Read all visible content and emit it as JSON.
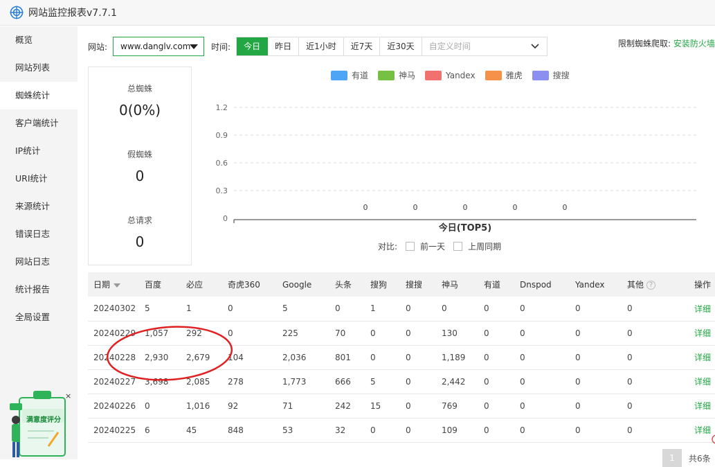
{
  "app": {
    "title": "网站监控报表v7.7.1"
  },
  "sidebar": {
    "items": [
      {
        "label": "概览"
      },
      {
        "label": "网站列表"
      },
      {
        "label": "蜘蛛统计"
      },
      {
        "label": "客户端统计"
      },
      {
        "label": "IP统计"
      },
      {
        "label": "URI统计"
      },
      {
        "label": "来源统计"
      },
      {
        "label": "错误日志"
      },
      {
        "label": "网站日志"
      },
      {
        "label": "统计报告"
      },
      {
        "label": "全局设置"
      }
    ],
    "active_index": 2
  },
  "filter": {
    "site_label": "网站:",
    "site_value": "www.danglv.com",
    "time_label": "时间:",
    "time_buttons": [
      "今日",
      "昨日",
      "近1小时",
      "近7天",
      "近30天"
    ],
    "active_time": "今日",
    "custom_time_placeholder": "自定义时间",
    "limit_label": "限制蜘蛛爬取:",
    "limit_link": "安装防火墙"
  },
  "stats": {
    "total_spider_label": "总蜘蛛",
    "total_spider_value": "0(0%)",
    "fake_spider_label": "假蜘蛛",
    "fake_spider_value": "0",
    "total_requests_label": "总请求",
    "total_requests_value": "0"
  },
  "chart_data": {
    "type": "bar",
    "xlabel": "今日(TOP5)",
    "ylim": [
      0,
      1.2
    ],
    "yticks": [
      "1.2",
      "0.9",
      "0.6",
      "0.3",
      "0"
    ],
    "grid": true,
    "legend": "top",
    "series": [
      {
        "name": "有道",
        "color": "#4ea5f5",
        "values": [
          0
        ]
      },
      {
        "name": "神马",
        "color": "#76c043",
        "values": [
          0
        ]
      },
      {
        "name": "Yandex",
        "color": "#f0716e",
        "values": [
          0
        ]
      },
      {
        "name": "雅虎",
        "color": "#f6914a",
        "values": [
          0
        ]
      },
      {
        "name": "搜搜",
        "color": "#8b8ff0",
        "values": [
          0
        ]
      }
    ],
    "value_labels": [
      "0",
      "0",
      "0",
      "0",
      "0"
    ]
  },
  "compare": {
    "label": "对比:",
    "options": [
      "前一天",
      "上周同期"
    ]
  },
  "table": {
    "columns": [
      "日期",
      "百度",
      "必应",
      "奇虎360",
      "Google",
      "头条",
      "搜狗",
      "搜搜",
      "神马",
      "有道",
      "Dnspod",
      "Yandex",
      "其他",
      "操作"
    ],
    "rows": [
      [
        "20240302",
        "5",
        "1",
        "0",
        "5",
        "0",
        "1",
        "0",
        "0",
        "0",
        "0",
        "0",
        "0",
        "详细"
      ],
      [
        "20240229",
        "1,057",
        "292",
        "0",
        "225",
        "70",
        "0",
        "0",
        "130",
        "0",
        "0",
        "0",
        "0",
        "详细"
      ],
      [
        "20240228",
        "2,930",
        "2,679",
        "104",
        "2,036",
        "801",
        "0",
        "0",
        "1,189",
        "0",
        "0",
        "0",
        "0",
        "详细"
      ],
      [
        "20240227",
        "3,698",
        "2,085",
        "278",
        "1,773",
        "666",
        "5",
        "0",
        "2,442",
        "0",
        "0",
        "0",
        "0",
        "详细"
      ],
      [
        "20240226",
        "0",
        "1,016",
        "92",
        "71",
        "242",
        "15",
        "0",
        "769",
        "0",
        "0",
        "0",
        "0",
        "详细"
      ],
      [
        "20240225",
        "6",
        "45",
        "848",
        "53",
        "32",
        "0",
        "0",
        "109",
        "0",
        "0",
        "0",
        "0",
        "详细"
      ]
    ]
  },
  "pagination": {
    "current": "1",
    "total_label": "共6条"
  },
  "widget": {
    "label": "满意度评分",
    "close": "×"
  },
  "colors": {
    "accent": "#22a744",
    "annotation": "#e02020"
  }
}
